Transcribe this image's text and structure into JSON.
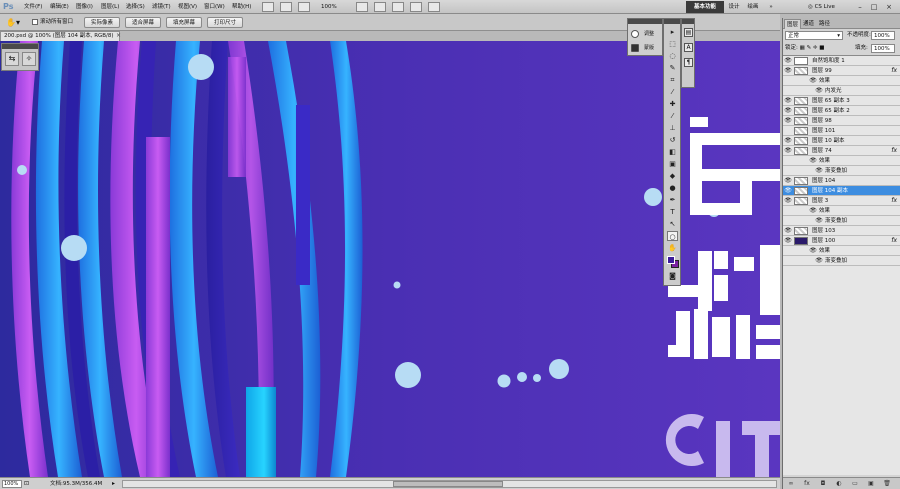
{
  "app": {
    "logo": "Ps"
  },
  "menubar": {
    "items": [
      "文件(F)",
      "编辑(E)",
      "图像(I)",
      "图层(L)",
      "选择(S)",
      "滤镜(T)",
      "视图(V)",
      "窗口(W)",
      "帮助(H)"
    ],
    "zoom": "100%",
    "workspaces": {
      "basic": "基本功能",
      "design": "设计",
      "draw": "绘画",
      "more": "»"
    },
    "cslive": "CS Live"
  },
  "optbar": {
    "scroll_all": "滚动所有窗口",
    "buttons": [
      "实际像素",
      "适合屏幕",
      "填充屏幕",
      "打印尺寸"
    ]
  },
  "document": {
    "tab": "200.psd @ 100% (图层 104 副本, RGB/8)"
  },
  "adjust_panel": {
    "items": [
      "调整",
      "蒙版"
    ]
  },
  "layers": {
    "tabs": [
      "图层",
      "通道",
      "路径"
    ],
    "blend_mode": "正常",
    "opacity_label": "不透明度:",
    "opacity_value": "100%",
    "lock_label": "锁定:",
    "fill_label": "填充:",
    "fill_value": "100%",
    "rows": [
      {
        "name": "自然饱和度 1",
        "kind": "adjust",
        "eye": true
      },
      {
        "name": "图层 99",
        "kind": "layer",
        "eye": true,
        "fx": true
      },
      {
        "name": "效果",
        "kind": "effect"
      },
      {
        "name": "内发光",
        "kind": "effect-item"
      },
      {
        "name": "图层 65 副本 3",
        "kind": "layer",
        "eye": true
      },
      {
        "name": "图层 65 副本 2",
        "kind": "layer",
        "eye": true
      },
      {
        "name": "图层 98",
        "kind": "layer",
        "eye": true
      },
      {
        "name": "图层 101",
        "kind": "layer",
        "eye": false
      },
      {
        "name": "图层 10 副本",
        "kind": "layer",
        "eye": true
      },
      {
        "name": "图层 74",
        "kind": "layer",
        "eye": true,
        "fx": true
      },
      {
        "name": "效果",
        "kind": "effect"
      },
      {
        "name": "渐变叠加",
        "kind": "effect-item"
      },
      {
        "name": "图层 104",
        "kind": "layer",
        "eye": true
      },
      {
        "name": "图层 104 副本",
        "kind": "layer",
        "eye": true,
        "selected": true
      },
      {
        "name": "图层 3",
        "kind": "layer",
        "eye": true,
        "fx": true
      },
      {
        "name": "效果",
        "kind": "effect"
      },
      {
        "name": "渐变叠加",
        "kind": "effect-item"
      },
      {
        "name": "图层 103",
        "kind": "layer",
        "eye": true
      },
      {
        "name": "图层 100",
        "kind": "layer",
        "eye": true,
        "fx": true,
        "dark": true
      },
      {
        "name": "效果",
        "kind": "effect"
      },
      {
        "name": "渐变叠加",
        "kind": "effect-item"
      }
    ]
  },
  "status": {
    "zoom": "100%",
    "docinfo": "文档:95.3M/356.4M"
  },
  "canvas": {
    "bg_color": "#4e32b7",
    "letters": "CIT"
  }
}
